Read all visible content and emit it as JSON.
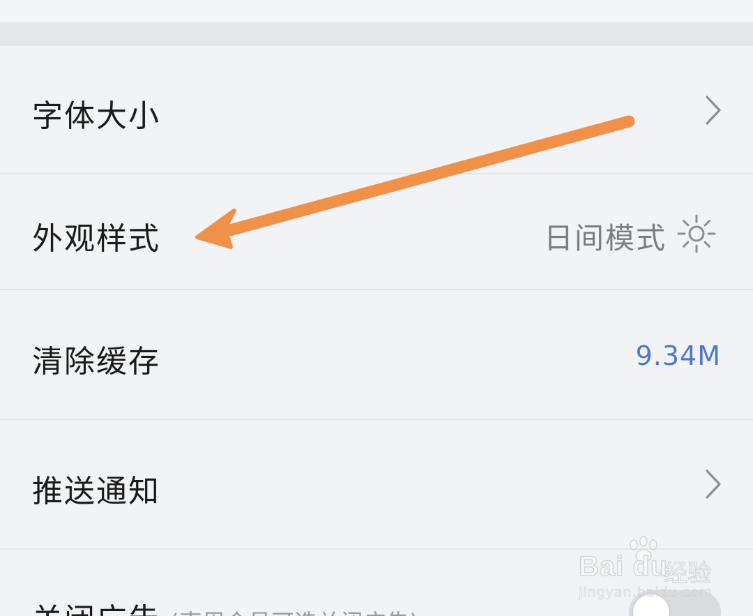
{
  "settings": {
    "items": [
      {
        "label": "字体大小"
      },
      {
        "label": "外观样式",
        "value": "日间模式"
      },
      {
        "label": "清除缓存",
        "value": "9.34M"
      },
      {
        "label": "推送通知"
      },
      {
        "label": "关闭广告",
        "hint": "(南周会员可选关闭广告)",
        "toggle_on": false
      }
    ]
  },
  "watermark": {
    "brand": "Bai du",
    "name": "经验",
    "url": "jingyan.baidu.com"
  },
  "colors": {
    "background": "#f2f3f6",
    "section_gap": "#e6e7ea",
    "label_text": "#1b1b1d",
    "secondary_text": "#7c7d82",
    "link_value": "#4f78c8",
    "annotation_arrow": "#f0914a"
  },
  "icons": {
    "chevron": "chevron-right-icon",
    "mode": "sun-icon",
    "annotation": "arrow-annotation"
  }
}
